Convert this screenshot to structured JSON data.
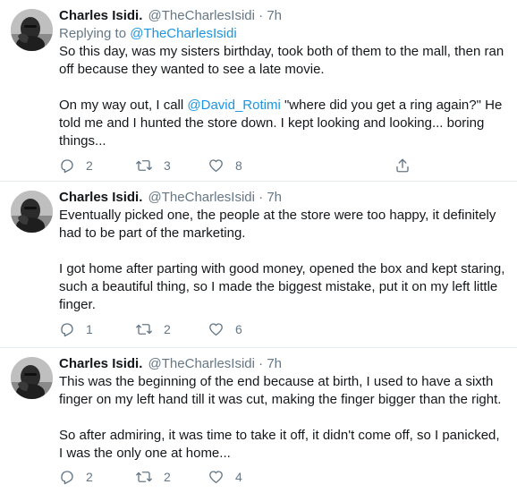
{
  "tweets": [
    {
      "display_name": "Charles Isidi.",
      "handle": "@TheCharlesIsidi",
      "separator": "·",
      "time": "7h",
      "replying_prefix": "Replying to",
      "replying_handle": "@TheCharlesIsidi",
      "paragraph1": "So this day, was my sisters birthday, took both of them to the mall, then ran off because they wanted to see a late movie.",
      "paragraph2_before": "On my way out, I call ",
      "paragraph2_mention": "@David_Rotimi",
      "paragraph2_after": " \"where did you get a ring again?\" He told me and I hunted the store down. I kept looking and looking... boring things...",
      "replies": "2",
      "retweets": "3",
      "likes": "8"
    },
    {
      "display_name": "Charles Isidi.",
      "handle": "@TheCharlesIsidi",
      "separator": "·",
      "time": "7h",
      "paragraph1": "Eventually picked one, the people at the store were too happy, it definitely had to be part of the marketing.",
      "paragraph2": "I got home after parting with good money, opened the box and kept staring, such a beautiful thing, so I made the biggest mistake, put it on my left little finger.",
      "replies": "1",
      "retweets": "2",
      "likes": "6"
    },
    {
      "display_name": "Charles Isidi.",
      "handle": "@TheCharlesIsidi",
      "separator": "·",
      "time": "7h",
      "paragraph1": "This was the beginning of the end because at birth, I used to have a sixth finger on my left hand till it was cut, making the finger bigger than the right.",
      "paragraph2": "So after admiring, it was time to take it off, it didn't come off, so I panicked, I was the only one at home...",
      "replies": "2",
      "retweets": "2",
      "likes": "4"
    }
  ],
  "icons": {
    "reply": "reply-icon",
    "retweet": "retweet-icon",
    "like": "heart-icon",
    "share": "share-icon"
  },
  "colors": {
    "link": "#1b95e0",
    "muted": "#657786",
    "text": "#14171a",
    "divider": "#e6ecf0"
  }
}
